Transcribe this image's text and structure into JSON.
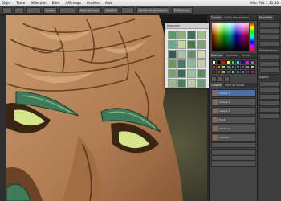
{
  "menubar": {
    "items": [
      "Objet",
      "Texte",
      "Sélection",
      "Effet",
      "Affichage",
      "Fenêtre",
      "Aide"
    ],
    "clock": "Mer. Fév 1  11:30"
  },
  "optbar": {
    "btn1": "Aucun",
    "btn2": "Style de base",
    "btn3": "Opacité",
    "btn4": "Option de document",
    "btn5": "Préférences"
  },
  "swatch_float": {
    "title": "Nuancier",
    "swatches": [
      "#5c9a6a",
      "#8ab07a",
      "#3f6f58",
      "#9cc08a",
      "#6aa890",
      "#c4d6a0",
      "#4d7a4a",
      "#7aa27a",
      "#2f5f4a",
      "#a4c49a",
      "#5d8f6f",
      "#d0dcb0",
      "#6e9a58",
      "#4a7a6a",
      "#8fb89a",
      "#c0d0a8",
      "#78a070",
      "#3a6a50",
      "#a0c0a0",
      "#5a8a60",
      "#9ab890",
      "#4d805c",
      "#b8ccaa",
      "#6a9a7a"
    ]
  },
  "panel": {
    "tabs": [
      "Couleur",
      "Guide des couleurs"
    ],
    "swatches_tabs": [
      "Nuancier",
      "Symboles",
      "Formes"
    ],
    "layers_tabs": [
      "Calques",
      "Plans de travail"
    ],
    "layers": [
      "Calque 1",
      "Calque 2",
      "Calque 3",
      "Fond",
      "Contours",
      "Ombres"
    ],
    "swatch_colors": [
      "#ffffff",
      "#000000",
      "#ff0000",
      "#ffff00",
      "#00ff00",
      "#00ffff",
      "#0000ff",
      "#ff00ff",
      "#808080",
      "#c0392b",
      "#e67e22",
      "#f1c40f",
      "#27ae60",
      "#16a085",
      "#2980b9",
      "#8e44ad",
      "#7f8c8d",
      "#bdc3c7",
      "#6b3e1e",
      "#a0522d",
      "#d2a679",
      "#556b2f",
      "#8fbc8f",
      "#2e8b57",
      "#4682b4",
      "#483d8b",
      "#c71585"
    ]
  },
  "panel2": {
    "tabs": [
      "Propriétés",
      "Calques"
    ],
    "section1": "Transparence",
    "section2": "Aspect"
  },
  "colors": {
    "skin": "#b8875e",
    "eyebrow": "#3f7a5a"
  }
}
